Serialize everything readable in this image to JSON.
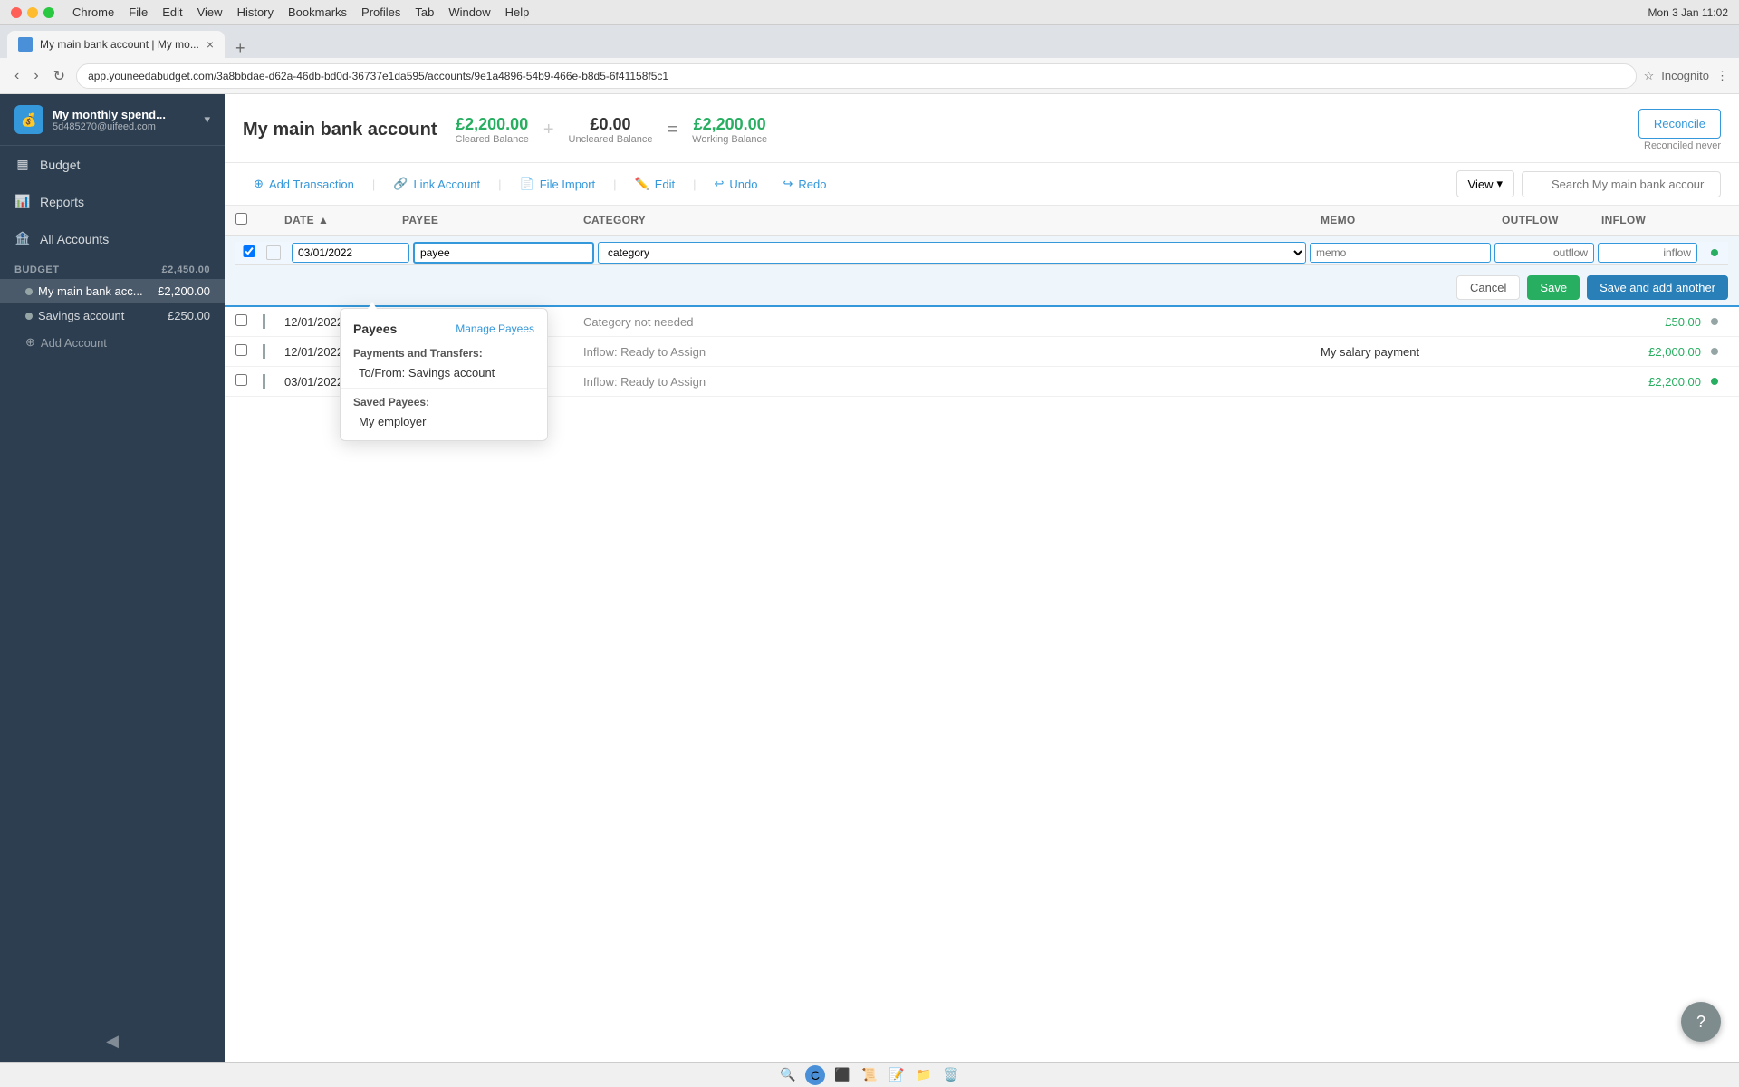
{
  "browser": {
    "tab_title": "My main bank account | My mo...",
    "url": "app.youneedabudget.com/3a8bbdae-d62a-46db-bd0d-36737e1da595/accounts/9e1a4896-54b9-466e-b8d5-6f41158f5c1",
    "new_tab_label": "+",
    "back_label": "‹",
    "forward_label": "›",
    "refresh_label": "↻",
    "profile_label": "Incognito",
    "time": "Mon 3 Jan  11:02"
  },
  "sidebar": {
    "brand_name": "My monthly spend...",
    "brand_sub": "5d485270@uifeed.com",
    "nav_items": [
      {
        "id": "budget",
        "label": "Budget",
        "icon": "▦"
      },
      {
        "id": "reports",
        "label": "Reports",
        "icon": "📊"
      },
      {
        "id": "all-accounts",
        "label": "All Accounts",
        "icon": "🏦"
      }
    ],
    "section_budget": "BUDGET",
    "section_balance": "£2,450.00",
    "accounts": [
      {
        "id": "main-bank",
        "label": "My main bank acc...",
        "balance": "£2,200.00",
        "active": true
      },
      {
        "id": "savings",
        "label": "Savings account",
        "balance": "£250.00",
        "active": false
      }
    ],
    "add_account_label": "Add Account"
  },
  "account": {
    "title": "My main bank account",
    "cleared_balance": "£2,200.00",
    "cleared_label": "Cleared Balance",
    "uncleared_balance": "£0.00",
    "uncleared_label": "Uncleared Balance",
    "working_balance": "£2,200.00",
    "working_label": "Working Balance",
    "reconcile_label": "Reconcile",
    "reconciled_label": "Reconciled never"
  },
  "toolbar": {
    "add_transaction": "Add Transaction",
    "link_account": "Link Account",
    "file_import": "File Import",
    "edit": "Edit",
    "undo": "Undo",
    "redo": "Redo",
    "view": "View",
    "search_placeholder": "Search My main bank accour"
  },
  "table": {
    "headers": [
      "",
      "",
      "DATE",
      "PAYEE",
      "CATEGORY",
      "MEMO",
      "OUTFLOW",
      "INFLOW",
      ""
    ],
    "edit_row": {
      "date": "03/01/2022",
      "payee_placeholder": "payee",
      "category_placeholder": "category",
      "memo_placeholder": "memo",
      "outflow_placeholder": "outflow",
      "inflow_placeholder": "inflow"
    },
    "action_cancel": "Cancel",
    "action_save": "Save",
    "action_save_add": "Save and add another",
    "rows": [
      {
        "date": "12/01/2022",
        "payee": "",
        "category": "Category not needed",
        "memo": "",
        "outflow": "",
        "inflow": "£50.00",
        "cleared": "gray"
      },
      {
        "date": "12/01/2022",
        "payee": "",
        "category": "Inflow: Ready to Assign",
        "memo": "My salary payment",
        "outflow": "",
        "inflow": "£2,000.00",
        "cleared": "gray"
      },
      {
        "date": "03/01/2022",
        "payee": "",
        "category": "Inflow: Ready to Assign",
        "memo": "",
        "outflow": "",
        "inflow": "£2,200.00",
        "cleared": "green"
      }
    ]
  },
  "payees_dropdown": {
    "title": "Payees",
    "manage_label": "Manage Payees",
    "section_payments": "Payments and Transfers:",
    "payments_items": [
      "To/From: Savings account"
    ],
    "section_saved": "Saved Payees:",
    "saved_items": [
      "My employer"
    ]
  },
  "help": {
    "label": "?"
  }
}
